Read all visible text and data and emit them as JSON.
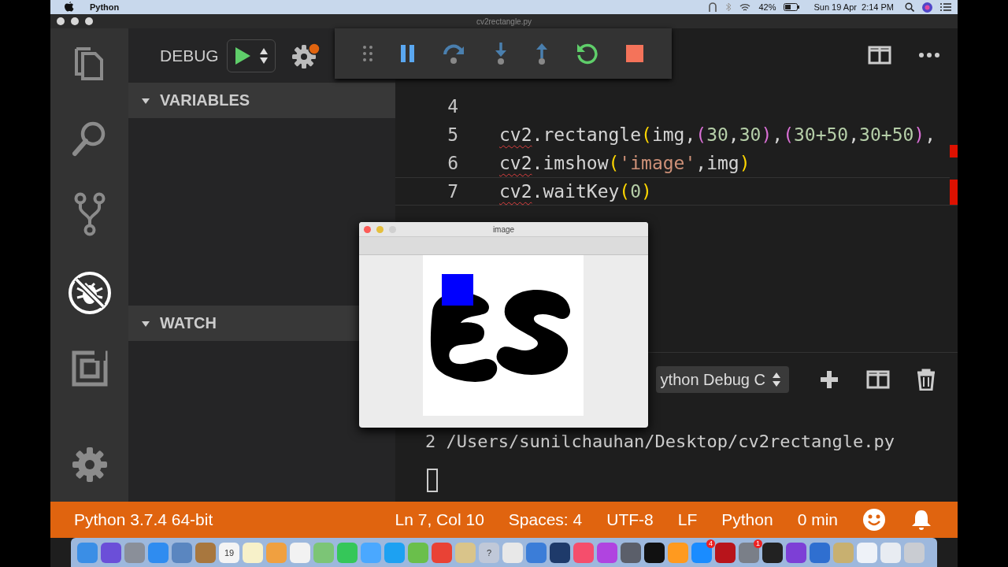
{
  "menu_bar": {
    "app": "Python",
    "battery": "42%",
    "clock": "Sun 19 Apr  2:14 PM"
  },
  "window": {
    "title": "cv2rectangle.py"
  },
  "activity_bar": [
    {
      "kind": "files",
      "selected": false
    },
    {
      "kind": "search",
      "selected": false
    },
    {
      "kind": "scm",
      "selected": false
    },
    {
      "kind": "debug",
      "selected": true
    },
    {
      "kind": "extensions",
      "selected": false
    },
    {
      "kind": "settings",
      "selected": false
    }
  ],
  "debug": {
    "label": "DEBUG"
  },
  "sections": [
    {
      "title": "VARIABLES",
      "expanded": true
    },
    {
      "title": "WATCH",
      "expanded": true
    }
  ],
  "editor": {
    "lines": [
      {
        "number": "4",
        "current": false
      },
      {
        "number": "5",
        "current": false,
        "tokens": [
          {
            "text": "cv2",
            "kind": "plain",
            "squiggle": true
          },
          {
            "text": ".rectangle",
            "kind": "plain"
          },
          {
            "text": "(",
            "kind": "paren"
          },
          {
            "text": "img,",
            "kind": "plain"
          },
          {
            "text": "(",
            "kind": "paren2"
          },
          {
            "text": "30",
            "kind": "number"
          },
          {
            "text": ",",
            "kind": "plain"
          },
          {
            "text": "30",
            "kind": "number"
          },
          {
            "text": ")",
            "kind": "paren2"
          },
          {
            "text": ",",
            "kind": "plain"
          },
          {
            "text": "(",
            "kind": "paren2"
          },
          {
            "text": "30+50",
            "kind": "number"
          },
          {
            "text": ",",
            "kind": "plain"
          },
          {
            "text": "30+50",
            "kind": "number"
          },
          {
            "text": ")",
            "kind": "paren2"
          },
          {
            "text": ",",
            "kind": "plain"
          }
        ]
      },
      {
        "number": "6",
        "current": false,
        "tokens": [
          {
            "text": "cv2",
            "kind": "plain",
            "squiggle": true
          },
          {
            "text": ".imshow",
            "kind": "plain"
          },
          {
            "text": "(",
            "kind": "paren"
          },
          {
            "text": "'image'",
            "kind": "string"
          },
          {
            "text": ",img",
            "kind": "plain"
          },
          {
            "text": ")",
            "kind": "paren"
          }
        ]
      },
      {
        "number": "7",
        "current": true,
        "tokens": [
          {
            "text": "cv2",
            "kind": "plain",
            "squiggle": true
          },
          {
            "text": ".waitKey",
            "kind": "plain"
          },
          {
            "text": "(",
            "kind": "paren"
          },
          {
            "text": "0",
            "kind": "number"
          },
          {
            "text": ")",
            "kind": "paren"
          }
        ]
      }
    ]
  },
  "terminal": {
    "dropdown": "ython Debug C",
    "lines": [
      "2 /Users/sunilchauhan/Desktop/cv2rectangle.py"
    ]
  },
  "image_window": {
    "title": "image"
  },
  "status_bar": {
    "left": [
      "Python 3.7.4 64-bit"
    ],
    "right": [
      "Ln 7, Col 10",
      "Spaces: 4",
      "UTF-8",
      "LF",
      "Python",
      "0 min"
    ]
  },
  "dock": {
    "items": [
      {
        "color": "#3a8ee6"
      },
      {
        "color": "#6b4fd8"
      },
      {
        "color": "#8a8f99"
      },
      {
        "color": "#2f8cf0"
      },
      {
        "color": "#5a86c0"
      },
      {
        "color": "#a8773e"
      },
      {
        "color": "#f4f4f4",
        "label": "19"
      },
      {
        "color": "#f7f1c9"
      },
      {
        "color": "#f0a040"
      },
      {
        "color": "#f2f2f2"
      },
      {
        "color": "#7cc576"
      },
      {
        "color": "#35c759"
      },
      {
        "color": "#4aa8ff"
      },
      {
        "color": "#1da1f2"
      },
      {
        "color": "#6abf4b"
      },
      {
        "color": "#e94235"
      },
      {
        "color": "#d9c48a"
      },
      {
        "color": "#c0c8d8",
        "label": "?"
      },
      {
        "color": "#e8e8e8"
      },
      {
        "color": "#3b7dd8"
      },
      {
        "color": "#1e3a6a"
      },
      {
        "color": "#f54e6c"
      },
      {
        "color": "#b044e0"
      },
      {
        "color": "#5b5f6a"
      },
      {
        "color": "#111111"
      },
      {
        "color": "#ff9a1f"
      },
      {
        "color": "#1a8cff",
        "badge": "4"
      },
      {
        "color": "#b8141b"
      },
      {
        "color": "#7a7f88",
        "badge": "1"
      },
      {
        "color": "#222222"
      },
      {
        "color": "#7d3fd6"
      },
      {
        "color": "#2f6fd0"
      },
      {
        "color": "#c8b070"
      },
      {
        "color": "#eef2f8"
      },
      {
        "color": "#e8ecf2"
      },
      {
        "color": "#c9ccd2"
      }
    ]
  }
}
